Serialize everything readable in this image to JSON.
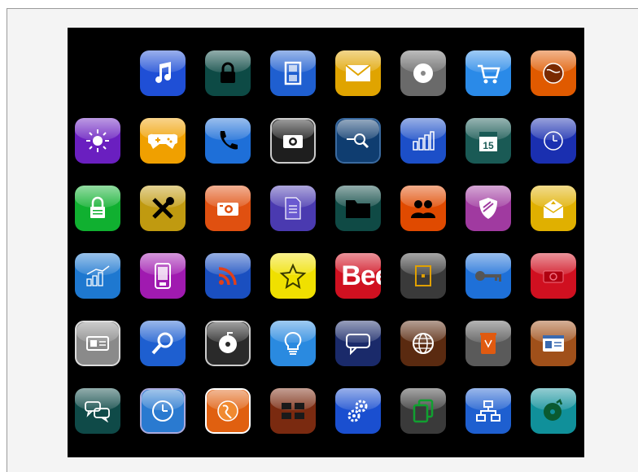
{
  "icons": [
    {
      "name": "music-note-icon",
      "bg": "#1f4fd6"
    },
    {
      "name": "lock-icon",
      "bg": "#0d4a45"
    },
    {
      "name": "film-strip-icon",
      "bg": "#1f5fd0"
    },
    {
      "name": "mail-envelope-icon",
      "bg": "#e0a400"
    },
    {
      "name": "disc-icon",
      "bg": "#6a6a6a"
    },
    {
      "name": "shopping-cart-icon",
      "bg": "#2a8ae8"
    },
    {
      "name": "globe-icon",
      "bg": "#e05a00"
    },
    {
      "name": "sun-settings-icon",
      "bg": "#6a1fc0"
    },
    {
      "name": "gamepad-icon",
      "bg": "#f0a000"
    },
    {
      "name": "phone-icon",
      "bg": "#1e6fd8"
    },
    {
      "name": "camera-icon",
      "bg": "#1e1e1e"
    },
    {
      "name": "search-zoom-icon",
      "bg": "#0f3d70"
    },
    {
      "name": "bar-chart-icon",
      "bg": "#1c4fc8"
    },
    {
      "name": "calendar-icon",
      "bg": "#1a5a55"
    },
    {
      "name": "clock-icon",
      "bg": "#1a2fb0"
    },
    {
      "name": "padlock-icon",
      "bg": "#10b030"
    },
    {
      "name": "tools-icon",
      "bg": "#c09a10"
    },
    {
      "name": "photo-camera-icon",
      "bg": "#e05010"
    },
    {
      "name": "document-icon",
      "bg": "#4a3ab0"
    },
    {
      "name": "folder-icon",
      "bg": "#0f4a45"
    },
    {
      "name": "users-icon",
      "bg": "#e04a00"
    },
    {
      "name": "shield-icon",
      "bg": "#a03aa0"
    },
    {
      "name": "inbox-icon",
      "bg": "#e0b000"
    },
    {
      "name": "growth-chart-icon",
      "bg": "#1e78d0"
    },
    {
      "name": "mobile-phone-icon",
      "bg": "#a01ab0"
    },
    {
      "name": "rss-feed-icon",
      "bg": "#1a4fc0"
    },
    {
      "name": "star-icon",
      "bg": "#f0e000"
    },
    {
      "name": "behance-icon",
      "bg": "#d01020",
      "text": "Bee"
    },
    {
      "name": "book-icon",
      "bg": "#3a3a3a"
    },
    {
      "name": "key-icon",
      "bg": "#1e70d8"
    },
    {
      "name": "red-camera-icon",
      "bg": "#d01020"
    },
    {
      "name": "id-card-icon",
      "bg": "#8a8a8a"
    },
    {
      "name": "magnifier-icon",
      "bg": "#1e5fd0"
    },
    {
      "name": "radiation-disc-icon",
      "bg": "#2a2a2a"
    },
    {
      "name": "lightbulb-icon",
      "bg": "#2a8ae0"
    },
    {
      "name": "chat-bubble-icon",
      "bg": "#1a2a6a"
    },
    {
      "name": "world-icon",
      "bg": "#5a2a10"
    },
    {
      "name": "trash-bin-icon",
      "bg": "#5a5a5a"
    },
    {
      "name": "contact-card-icon",
      "bg": "#a0501a"
    },
    {
      "name": "conversation-icon",
      "bg": "#0f4a48"
    },
    {
      "name": "clock-face-icon",
      "bg": "#2a7ad0"
    },
    {
      "name": "globe-orange-icon",
      "bg": "#e06010"
    },
    {
      "name": "grid-list-icon",
      "bg": "#7a2a10"
    },
    {
      "name": "gears-icon",
      "bg": "#1a4fd0"
    },
    {
      "name": "copy-pages-icon",
      "bg": "#3a3a3a"
    },
    {
      "name": "network-icon",
      "bg": "#1e5fd0"
    },
    {
      "name": "music-disc-icon",
      "bg": "#10909a"
    }
  ]
}
